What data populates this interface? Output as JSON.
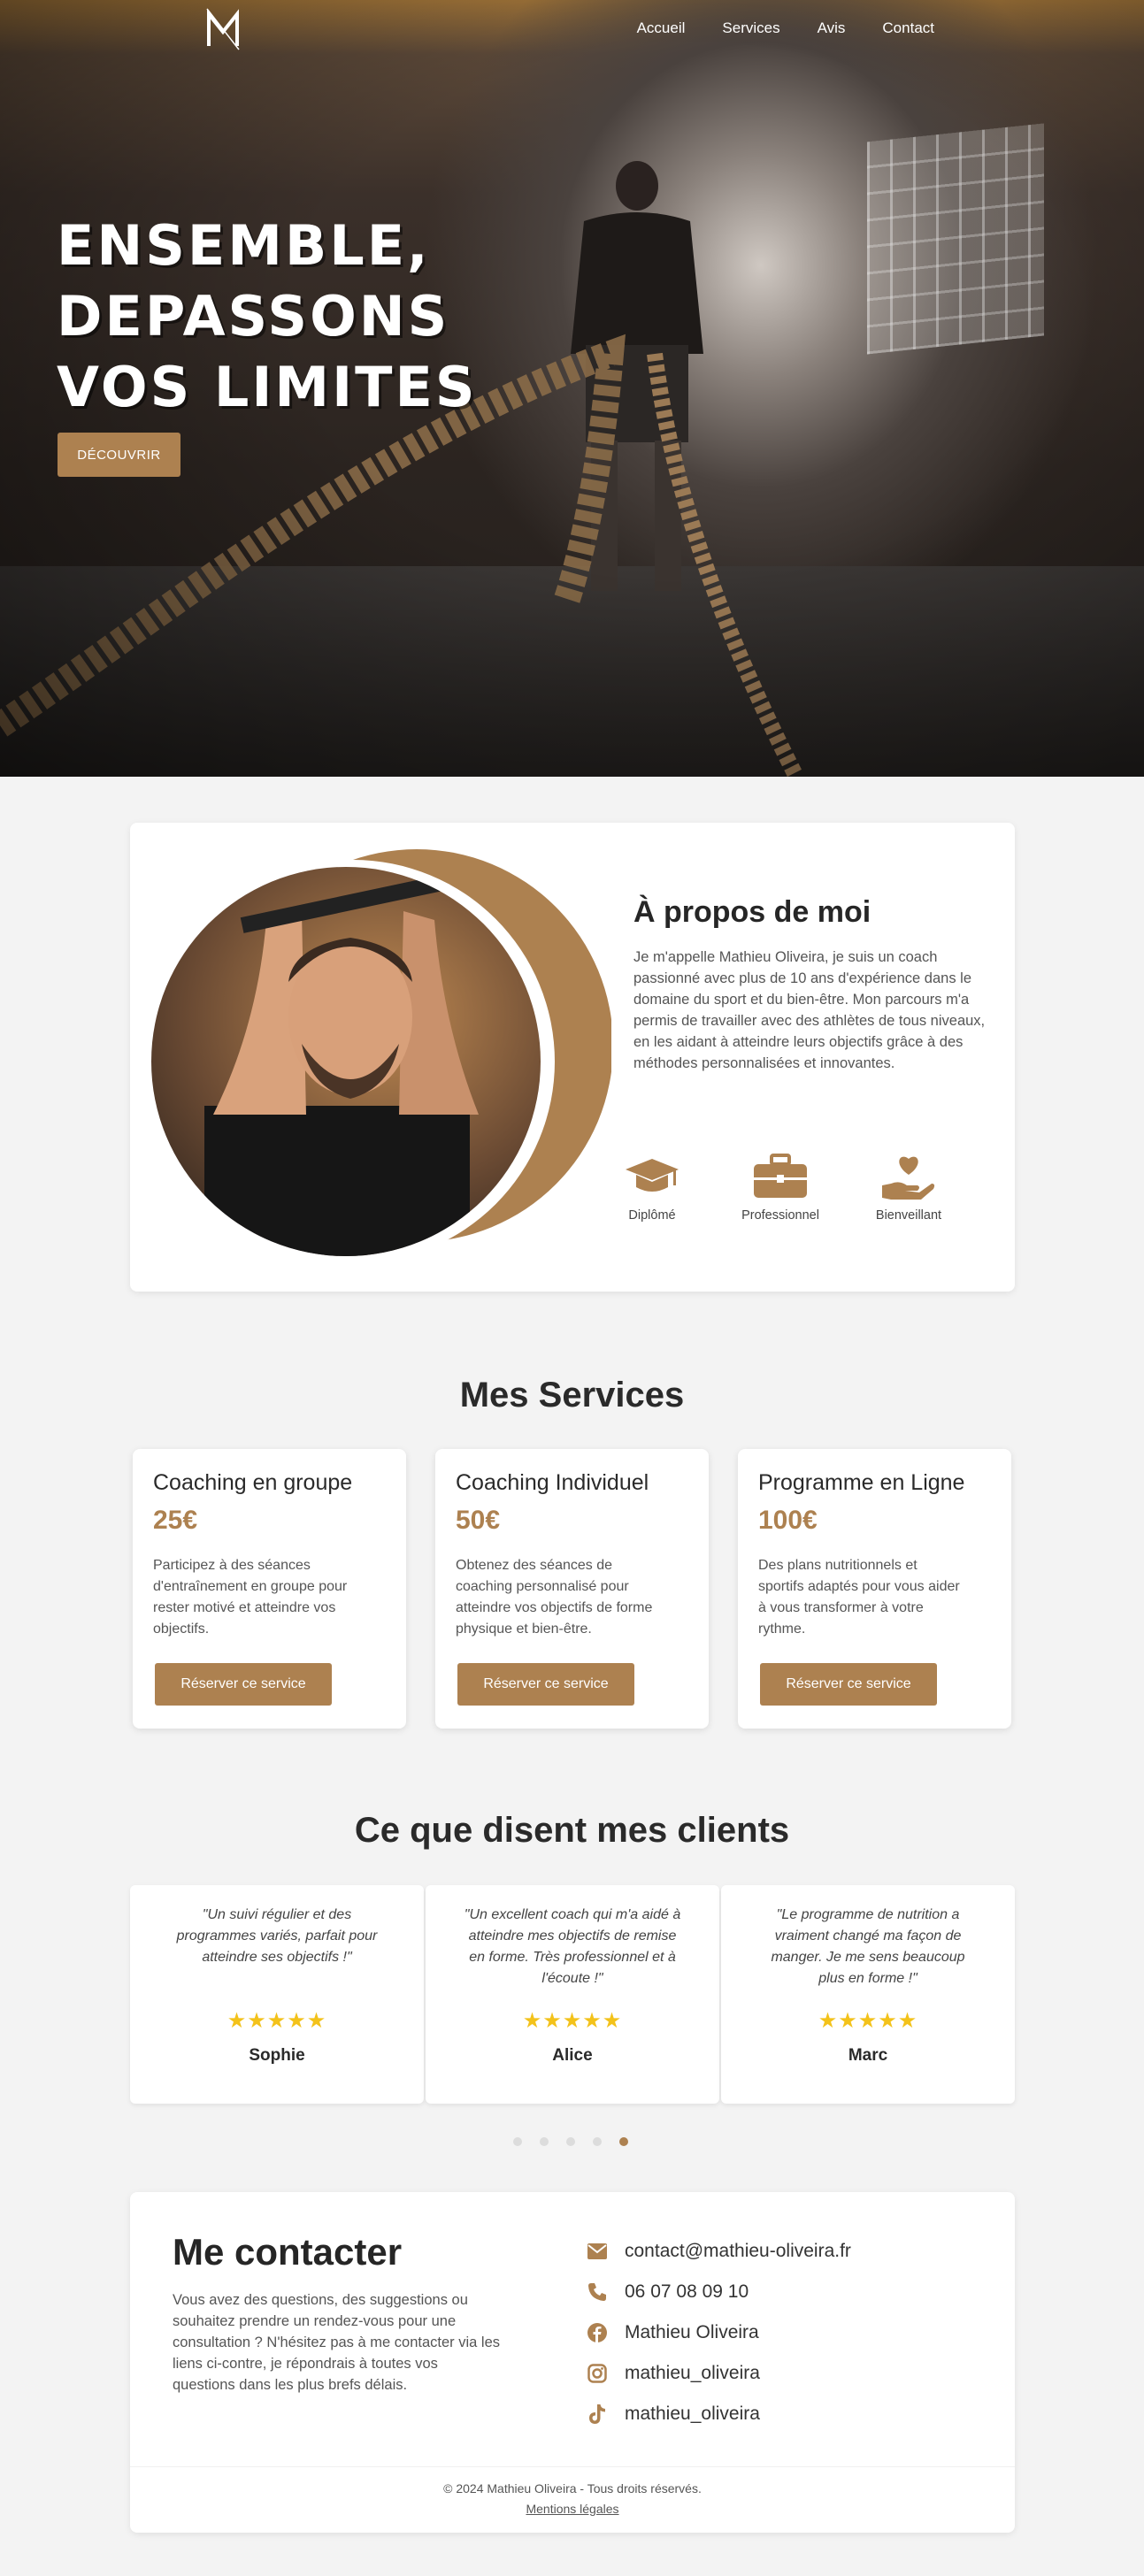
{
  "nav": {
    "logo_text": "M",
    "links": [
      "Accueil",
      "Services",
      "Avis",
      "Contact"
    ]
  },
  "hero": {
    "title_lines": [
      "ENSEMBLE,",
      "DEPASSONS",
      "VOS LIMITES"
    ],
    "cta": "DÉCOUVRIR"
  },
  "about": {
    "title": "À propos de moi",
    "text": "Je m'appelle Mathieu Oliveira, je suis un coach passionné avec plus de 10 ans d'expérience dans le domaine du sport et du bien-être. Mon parcours m'a permis de travailler avec des athlètes de tous niveaux, en les aidant à atteindre leurs objectifs grâce à des méthodes personnalisées et innovantes.",
    "features": [
      {
        "icon": "graduation-cap-icon",
        "label": "Diplômé"
      },
      {
        "icon": "briefcase-icon",
        "label": "Professionnel"
      },
      {
        "icon": "hand-heart-icon",
        "label": "Bienveillant"
      }
    ]
  },
  "services": {
    "title": "Mes Services",
    "items": [
      {
        "name": "Coaching en groupe",
        "price": "25€",
        "desc": "Participez à des séances d'entraînement en groupe pour rester motivé et atteindre vos objectifs.",
        "button": "Réserver ce service"
      },
      {
        "name": "Coaching Individuel",
        "price": "50€",
        "desc": "Obtenez des séances de coaching personnalisé pour atteindre vos objectifs de forme physique et bien-être.",
        "button": "Réserver ce service"
      },
      {
        "name": "Programme en Ligne",
        "price": "100€",
        "desc": "Des plans nutritionnels et sportifs adaptés pour vous aider à vous transformer à votre rythme.",
        "button": "Réserver ce service"
      }
    ]
  },
  "testimonials": {
    "title": "Ce que disent mes clients",
    "items": [
      {
        "quote": "\"Un suivi régulier et des programmes variés, parfait pour atteindre ses objectifs !\"",
        "stars": "★★★★★",
        "author": "Sophie"
      },
      {
        "quote": "\"Un excellent coach qui m'a aidé à atteindre mes objectifs de remise en forme. Très professionnel et à l'écoute !\"",
        "stars": "★★★★★",
        "author": "Alice"
      },
      {
        "quote": "\"Le programme de nutrition a vraiment changé ma façon de manger. Je me sens beaucoup plus en forme !\"",
        "stars": "★★★★★",
        "author": "Marc"
      }
    ],
    "dots_count": 5,
    "active_dot": 5
  },
  "contact": {
    "title": "Me contacter",
    "text": "Vous avez des questions, des suggestions ou souhaitez prendre un rendez-vous pour une consultation ? N'hésitez pas à me contacter via les liens ci-contre, je répondrais à toutes vos questions dans les plus brefs délais.",
    "items": [
      {
        "icon": "envelope-icon",
        "text": "contact@mathieu-oliveira.fr"
      },
      {
        "icon": "phone-icon",
        "text": "06 07 08 09 10"
      },
      {
        "icon": "facebook-icon",
        "text": "Mathieu Oliveira"
      },
      {
        "icon": "instagram-icon",
        "text": "mathieu_oliveira"
      },
      {
        "icon": "tiktok-icon",
        "text": "mathieu_oliveira"
      }
    ]
  },
  "footer": {
    "copyright": "© 2024 Mathieu Oliveira - Tous droits réservés.",
    "legal": "Mentions légales"
  },
  "colors": {
    "accent": "#ad8150",
    "stars": "#f3c21a",
    "background": "#f3f3f3"
  }
}
